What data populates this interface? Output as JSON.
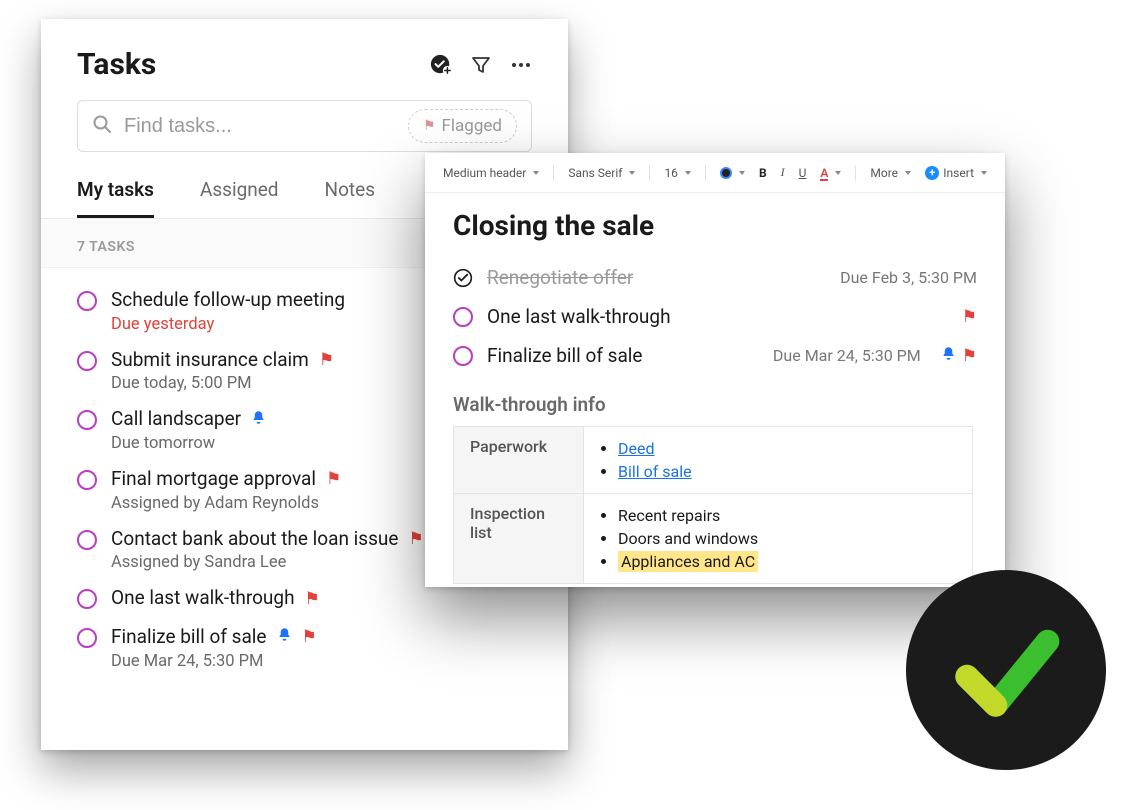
{
  "tasksPanel": {
    "title": "Tasks",
    "search": {
      "placeholder": "Find tasks...",
      "flaggedChip": "Flagged"
    },
    "tabs": {
      "myTasks": "My tasks",
      "assigned": "Assigned",
      "notes": "Notes"
    },
    "sectionLabel": "7 TASKS",
    "items": [
      {
        "title": "Schedule follow-up meeting",
        "sub": "Due yesterday",
        "overdue": true
      },
      {
        "title": "Submit insurance claim",
        "sub": "Due today, 5:00 PM",
        "flag": true
      },
      {
        "title": "Call landscaper",
        "sub": "Due tomorrow",
        "bell": true
      },
      {
        "title": "Final mortgage approval",
        "sub": "Assigned by Adam Reynolds",
        "flag": true
      },
      {
        "title": "Contact bank about the loan issue",
        "sub": "Assigned by Sandra Lee",
        "flag": true
      },
      {
        "title": "One last walk-through",
        "flag": true
      },
      {
        "title": "Finalize bill of sale",
        "sub": "Due Mar 24, 5:30 PM",
        "bell": true,
        "flag": true
      }
    ]
  },
  "notePanel": {
    "toolbar": {
      "headerStyle": "Medium header",
      "fontFamily": "Sans Serif",
      "fontSize": "16",
      "bold": "B",
      "italic": "I",
      "underline": "U",
      "fontColor": "A",
      "more": "More",
      "insert": "Insert"
    },
    "title": "Closing the sale",
    "tasks": [
      {
        "title": "Renegotiate offer",
        "done": true,
        "due": "Due Feb 3, 5:30 PM"
      },
      {
        "title": "One last walk-through",
        "flag": true
      },
      {
        "title": "Finalize bill of sale",
        "due": "Due Mar 24, 5:30 PM",
        "bell": true,
        "flag": true
      }
    ],
    "subhead": "Walk-through info",
    "table": {
      "paperworkLabel": "Paperwork",
      "paperwork": [
        "Deed",
        "Bill of sale"
      ],
      "inspectionLabel": "Inspection list",
      "inspection": [
        "Recent repairs",
        "Doors and windows",
        "Appliances and AC"
      ]
    }
  }
}
